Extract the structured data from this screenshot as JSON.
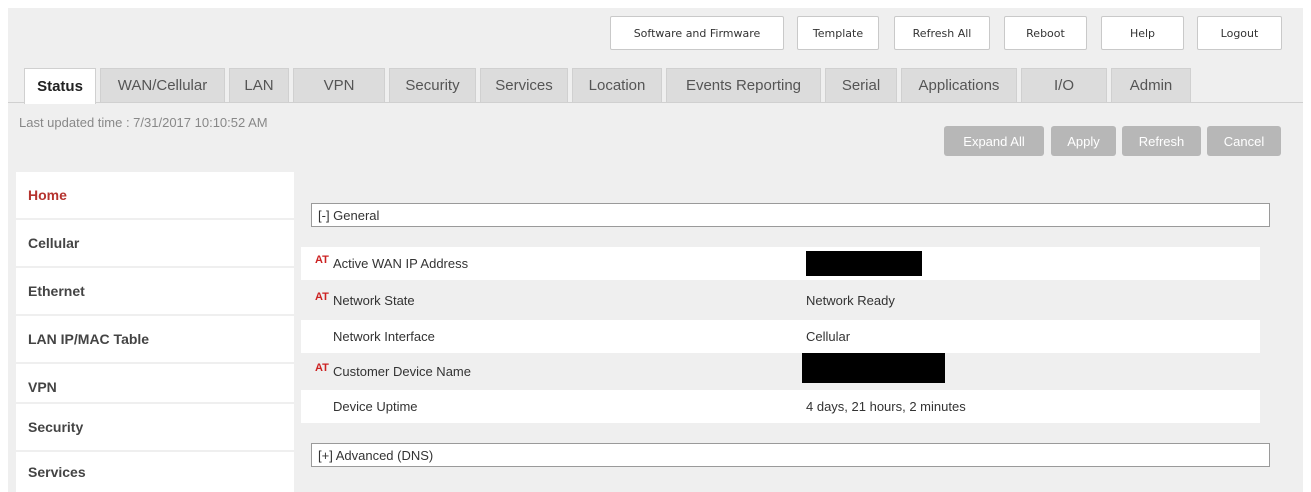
{
  "top_buttons": [
    {
      "label": "Software and Firmware"
    },
    {
      "label": "Template"
    },
    {
      "label": "Refresh All"
    },
    {
      "label": "Reboot"
    },
    {
      "label": "Help"
    },
    {
      "label": "Logout"
    }
  ],
  "tabs": [
    {
      "label": "Status"
    },
    {
      "label": "WAN/Cellular"
    },
    {
      "label": "LAN"
    },
    {
      "label": "VPN"
    },
    {
      "label": "Security"
    },
    {
      "label": "Services"
    },
    {
      "label": "Location"
    },
    {
      "label": "Events Reporting"
    },
    {
      "label": "Serial"
    },
    {
      "label": "Applications"
    },
    {
      "label": "I/O"
    },
    {
      "label": "Admin"
    }
  ],
  "active_tab": "Status",
  "last_updated": "Last updated time : 7/31/2017 10:10:52 AM",
  "actions": {
    "expand_all": "Expand All",
    "apply": "Apply",
    "refresh": "Refresh",
    "cancel": "Cancel"
  },
  "sidebar": {
    "items": [
      {
        "label": "Home"
      },
      {
        "label": "Cellular"
      },
      {
        "label": "Ethernet"
      },
      {
        "label": "LAN IP/MAC Table"
      },
      {
        "label": "VPN"
      },
      {
        "label": "Security"
      },
      {
        "label": "Services"
      }
    ],
    "active": "Home"
  },
  "general": {
    "header": "[-] General",
    "at_marker": "AT",
    "rows": [
      {
        "label": "Active WAN IP Address",
        "value": ""
      },
      {
        "label": "Network State",
        "value": "Network Ready"
      },
      {
        "label": "Network Interface",
        "value": "Cellular"
      },
      {
        "label": "Customer Device Name",
        "value": ""
      },
      {
        "label": "Device Uptime",
        "value": "4 days, 21 hours, 2 minutes"
      }
    ]
  },
  "advanced": {
    "header": "[+] Advanced (DNS)"
  },
  "colors": {
    "active_red": "#b5332e",
    "at_red": "#cc2222",
    "button_gray": "#b7b7b7",
    "panel_gray": "#efefef"
  }
}
